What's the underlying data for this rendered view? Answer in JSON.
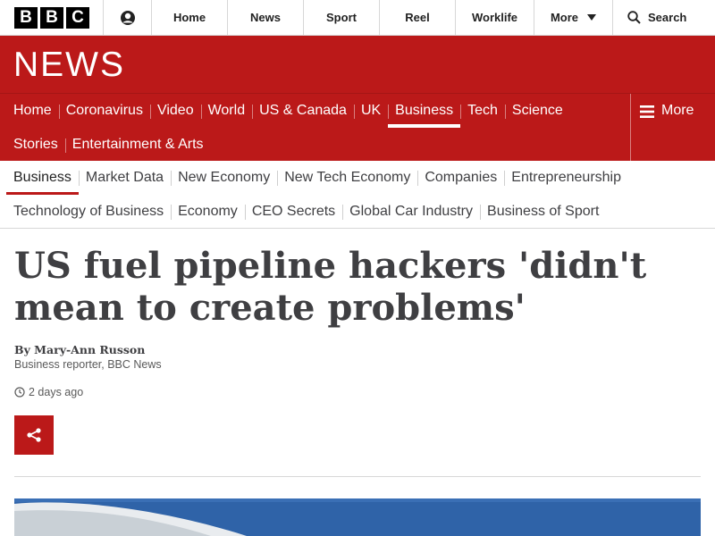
{
  "topbar": {
    "logo_letters": [
      "B",
      "B",
      "C"
    ],
    "account_icon": "account-icon",
    "items": [
      {
        "label": "Home"
      },
      {
        "label": "News"
      },
      {
        "label": "Sport"
      },
      {
        "label": "Reel"
      },
      {
        "label": "Worklife"
      },
      {
        "label": "More"
      }
    ],
    "search_label": "Search"
  },
  "banner": {
    "title": "NEWS",
    "color": "#bb1919"
  },
  "rednav": {
    "row1": [
      "Home",
      "Coronavirus",
      "Video",
      "World",
      "US & Canada",
      "UK",
      "Business",
      "Tech",
      "Science"
    ],
    "row2": [
      "Stories",
      "Entertainment & Arts"
    ],
    "active": "Business",
    "more_label": "More"
  },
  "subnav": {
    "row1": [
      "Business",
      "Market Data",
      "New Economy",
      "New Tech Economy",
      "Companies",
      "Entrepreneurship"
    ],
    "row2": [
      "Technology of Business",
      "Economy",
      "CEO Secrets",
      "Global Car Industry",
      "Business of Sport"
    ],
    "active": "Business"
  },
  "article": {
    "headline": "US fuel pipeline hackers 'didn't mean to create problems'",
    "byline": "By Mary-Ann Russon",
    "role": "Business reporter, BBC News",
    "timestamp": "2 days ago",
    "share_icon": "share-icon"
  }
}
